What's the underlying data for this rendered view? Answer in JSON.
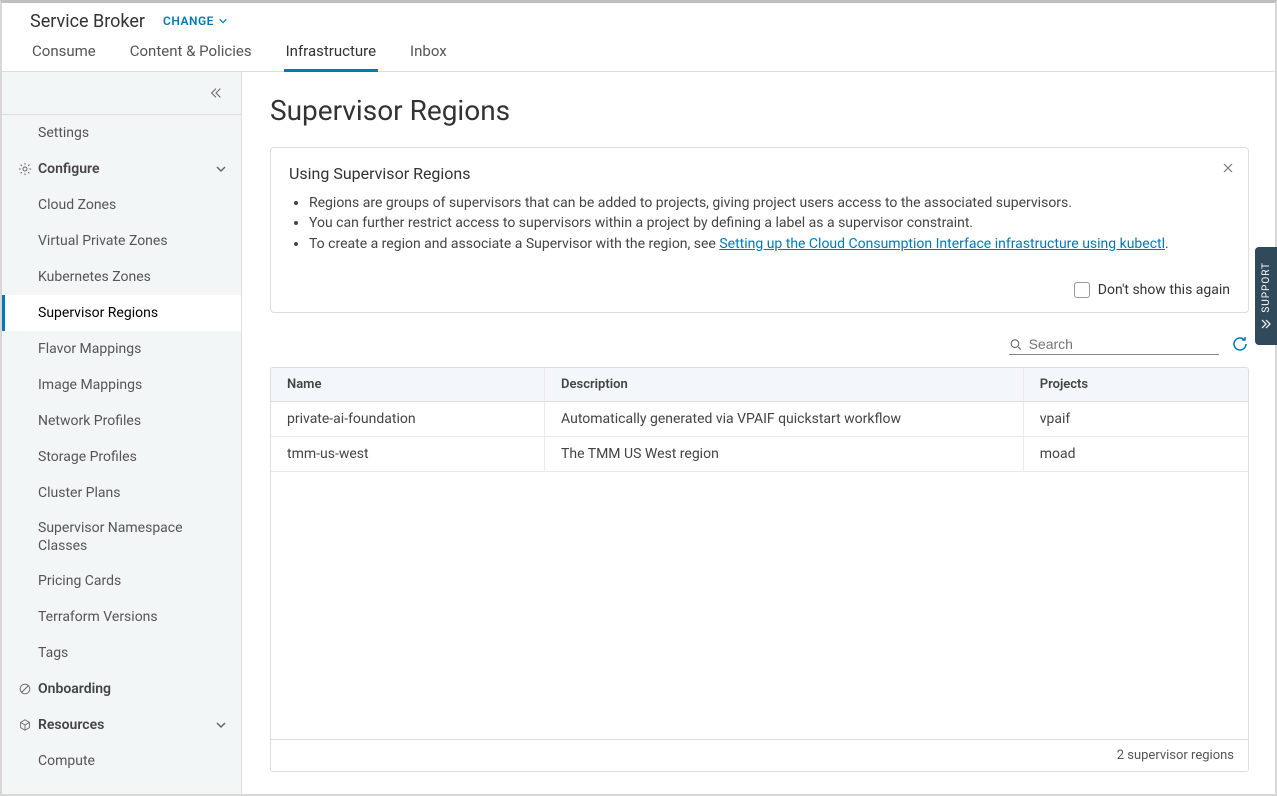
{
  "header": {
    "app_title": "Service Broker",
    "change_label": "CHANGE",
    "tabs": [
      "Consume",
      "Content & Policies",
      "Infrastructure",
      "Inbox"
    ],
    "active_tab": "Infrastructure"
  },
  "sidebar": {
    "settings": "Settings",
    "configure": "Configure",
    "configure_items": [
      "Cloud Zones",
      "Virtual Private Zones",
      "Kubernetes Zones",
      "Supervisor Regions",
      "Flavor Mappings",
      "Image Mappings",
      "Network Profiles",
      "Storage Profiles",
      "Cluster Plans",
      "Supervisor Namespace Classes",
      "Pricing Cards",
      "Terraform Versions",
      "Tags"
    ],
    "active_item": "Supervisor Regions",
    "onboarding": "Onboarding",
    "resources": "Resources",
    "resources_items": [
      "Compute"
    ]
  },
  "page": {
    "title": "Supervisor Regions"
  },
  "info_card": {
    "title": "Using Supervisor Regions",
    "bullets": [
      "Regions are groups of supervisors that can be added to projects, giving project users access to the associated supervisors.",
      "You can further restrict access to supervisors within a project by defining a label as a supervisor constraint."
    ],
    "bullet3_prefix": "To create a region and associate a Supervisor with the region, see ",
    "bullet3_link": "Setting up the Cloud Consumption Interface infrastructure using kubectl",
    "bullet3_suffix": ".",
    "dont_show": "Don't show this again"
  },
  "search": {
    "placeholder": "Search"
  },
  "table": {
    "columns": [
      "Name",
      "Description",
      "Projects"
    ],
    "rows": [
      {
        "name": "private-ai-foundation",
        "description": "Automatically generated via VPAIF quickstart workflow",
        "projects": "vpaif"
      },
      {
        "name": "tmm-us-west",
        "description": "The TMM US West region",
        "projects": "moad"
      }
    ],
    "footer": "2 supervisor regions"
  },
  "support_tab": "SUPPORT"
}
